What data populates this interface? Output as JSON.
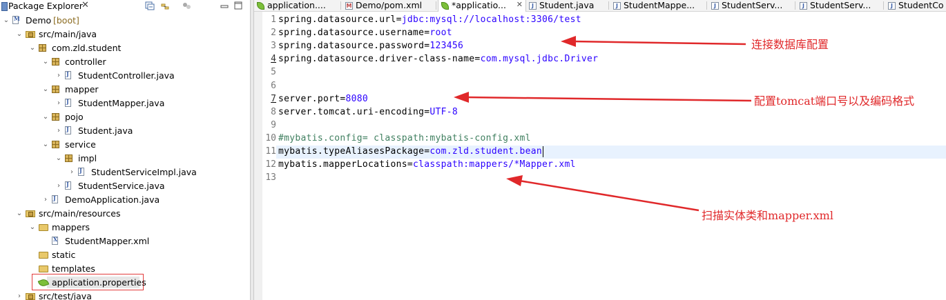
{
  "explorer": {
    "title": "Package Explorer",
    "close": "✕",
    "tree": [
      {
        "label": "Demo",
        "decoration": "[boot]",
        "icon": "project-icon",
        "chev": "⌄",
        "indent": 0
      },
      {
        "label": "src/main/java",
        "icon": "source-folder-icon",
        "chev": "⌄",
        "indent": 1
      },
      {
        "label": "com.zld.student",
        "icon": "package-icon",
        "chev": "⌄",
        "indent": 2
      },
      {
        "label": "controller",
        "icon": "package-icon",
        "chev": "⌄",
        "indent": 3
      },
      {
        "label": "StudentController.java",
        "icon": "java-file-icon",
        "chev": "›",
        "indent": 4
      },
      {
        "label": "mapper",
        "icon": "package-icon",
        "chev": "⌄",
        "indent": 3
      },
      {
        "label": "StudentMapper.java",
        "icon": "java-interface-icon",
        "chev": "›",
        "indent": 4
      },
      {
        "label": "pojo",
        "icon": "package-icon",
        "chev": "⌄",
        "indent": 3
      },
      {
        "label": "Student.java",
        "icon": "java-file-icon",
        "chev": "›",
        "indent": 4
      },
      {
        "label": "service",
        "icon": "package-icon",
        "chev": "⌄",
        "indent": 3
      },
      {
        "label": "impl",
        "icon": "package-icon",
        "chev": "⌄",
        "indent": 4
      },
      {
        "label": "StudentServiceImpl.java",
        "icon": "java-file-icon",
        "chev": "›",
        "indent": 5
      },
      {
        "label": "StudentService.java",
        "icon": "java-interface-icon",
        "chev": "›",
        "indent": 4
      },
      {
        "label": "DemoApplication.java",
        "icon": "java-file-icon",
        "chev": "›",
        "indent": 3
      },
      {
        "label": "src/main/resources",
        "icon": "source-folder-icon",
        "chev": "⌄",
        "indent": 1
      },
      {
        "label": "mappers",
        "icon": "folder-icon",
        "chev": "⌄",
        "indent": 2
      },
      {
        "label": "StudentMapper.xml",
        "icon": "xml-file-icon",
        "chev": "",
        "indent": 3
      },
      {
        "label": "static",
        "icon": "folder-icon",
        "chev": "",
        "indent": 2
      },
      {
        "label": "templates",
        "icon": "folder-icon",
        "chev": "",
        "indent": 2
      },
      {
        "label": "application.properties",
        "icon": "spring-leaf-icon",
        "chev": "",
        "indent": 2
      },
      {
        "label": "src/test/java",
        "icon": "source-folder-icon",
        "chev": "›",
        "indent": 1
      }
    ]
  },
  "tabs": [
    {
      "label": "application....",
      "icon": "spring-leaf-icon",
      "active": false
    },
    {
      "label": "Demo/pom.xml",
      "icon": "xml-file-icon",
      "active": false
    },
    {
      "label": "*applicatio...",
      "icon": "spring-leaf-icon",
      "active": true,
      "close": "✕"
    },
    {
      "label": "Student.java",
      "icon": "java-file-icon",
      "active": false
    },
    {
      "label": "StudentMappe...",
      "icon": "java-file-icon",
      "active": false
    },
    {
      "label": "StudentServ...",
      "icon": "java-file-icon",
      "active": false
    },
    {
      "label": "StudentServ...",
      "icon": "java-file-icon",
      "active": false
    },
    {
      "label": "StudentCo",
      "icon": "java-file-icon",
      "active": false
    }
  ],
  "editor": {
    "lines": [
      {
        "n": "1",
        "key": "spring.datasource.url=",
        "val": "jdbc:mysql://localhost:3306/test",
        "type": "kv"
      },
      {
        "n": "2",
        "key": "spring.datasource.username=",
        "val": "root",
        "type": "kv"
      },
      {
        "n": "3",
        "key": "spring.datasource.password=",
        "val": "123456",
        "type": "kv"
      },
      {
        "n": "4",
        "key": "spring.datasource.driver-class-name=",
        "val": "com.mysql.jdbc.Driver",
        "type": "kv",
        "mark": true
      },
      {
        "n": "5",
        "key": "",
        "val": "",
        "type": "kv"
      },
      {
        "n": "6",
        "key": "",
        "val": "",
        "type": "kv"
      },
      {
        "n": "7",
        "key": "server.port=",
        "val": "8080",
        "type": "kv",
        "mark": true
      },
      {
        "n": "8",
        "key": "server.tomcat.uri-encoding=",
        "val": "UTF-8",
        "type": "kv"
      },
      {
        "n": "9",
        "key": "",
        "val": "",
        "type": "kv"
      },
      {
        "n": "10",
        "key": "#mybatis.config= classpath:mybatis-config.xml",
        "val": "",
        "type": "comment"
      },
      {
        "n": "11",
        "key": "mybatis.typeAliasesPackage=",
        "val": "com.zld.student.bean",
        "type": "kv",
        "current": true
      },
      {
        "n": "12",
        "key": "mybatis.mapperLocations=",
        "val": "classpath:mappers/*Mapper.xml",
        "type": "kv"
      },
      {
        "n": "13",
        "key": "",
        "val": "",
        "type": "kv"
      }
    ]
  },
  "annotations": {
    "db_config": "连接数据库配置",
    "tomcat_config": "配置tomcat端口号以及编码格式",
    "mybatis_scan": "扫描实体类和mapper.xml"
  },
  "colors": {
    "annotation": "#e0282a",
    "value": "#2a00ff",
    "comment": "#3f7f5f",
    "current_line": "#e8f2fe",
    "selection_box": "#e23b3b"
  }
}
